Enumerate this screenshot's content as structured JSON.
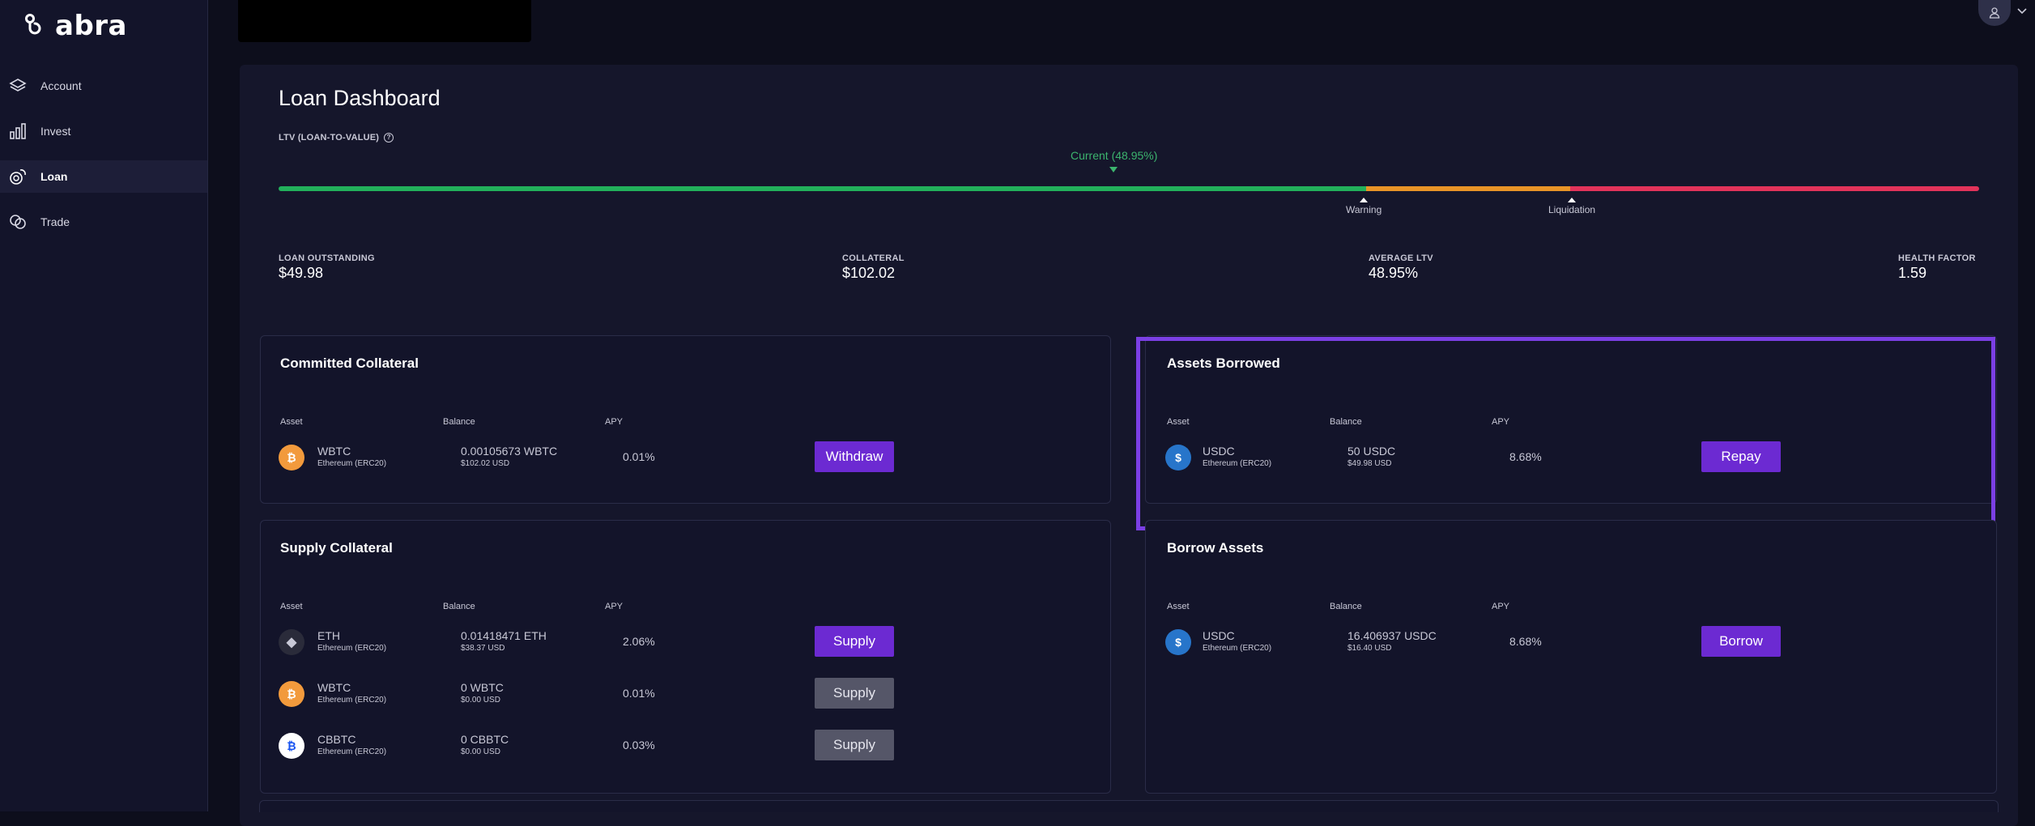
{
  "brand": {
    "name": "abra"
  },
  "sidebar": {
    "items": [
      {
        "label": "Account",
        "icon": "layers-icon"
      },
      {
        "label": "Invest",
        "icon": "bar-chart-icon"
      },
      {
        "label": "Loan",
        "icon": "coins-icon",
        "active": true
      },
      {
        "label": "Trade",
        "icon": "trade-coins-icon"
      }
    ]
  },
  "page": {
    "title": "Loan Dashboard"
  },
  "ltv": {
    "label": "LTV (LOAN-TO-VALUE)",
    "current_label": "Current (48.95%)",
    "warning_label": "Warning",
    "liquidation_label": "Liquidation"
  },
  "stats": {
    "loan_outstanding": {
      "label": "LOAN OUTSTANDING",
      "value": "$49.98"
    },
    "collateral": {
      "label": "COLLATERAL",
      "value": "$102.02"
    },
    "average_ltv": {
      "label": "AVERAGE LTV",
      "value": "48.95%"
    },
    "health_factor": {
      "label": "HEALTH FACTOR",
      "value": "1.59"
    }
  },
  "columns": {
    "asset": "Asset",
    "balance": "Balance",
    "apy": "APY"
  },
  "committed": {
    "title": "Committed Collateral",
    "rows": [
      {
        "name": "WBTC",
        "network": "Ethereum (ERC20)",
        "balance": "0.00105673 WBTC",
        "usd": "$102.02 USD",
        "apy": "0.01%",
        "button": "Withdraw"
      }
    ]
  },
  "borrowed": {
    "title": "Assets Borrowed",
    "rows": [
      {
        "name": "USDC",
        "network": "Ethereum (ERC20)",
        "balance": "50 USDC",
        "usd": "$49.98 USD",
        "apy": "8.68%",
        "button": "Repay"
      }
    ]
  },
  "supply": {
    "title": "Supply Collateral",
    "rows": [
      {
        "name": "ETH",
        "network": "Ethereum (ERC20)",
        "balance": "0.01418471 ETH",
        "usd": "$38.37 USD",
        "apy": "2.06%",
        "button": "Supply"
      },
      {
        "name": "WBTC",
        "network": "Ethereum (ERC20)",
        "balance": "0 WBTC",
        "usd": "$0.00 USD",
        "apy": "0.01%",
        "button": "Supply"
      },
      {
        "name": "CBBTC",
        "network": "Ethereum (ERC20)",
        "balance": "0 CBBTC",
        "usd": "$0.00 USD",
        "apy": "0.03%",
        "button": "Supply"
      }
    ]
  },
  "borrow": {
    "title": "Borrow Assets",
    "rows": [
      {
        "name": "USDC",
        "network": "Ethereum (ERC20)",
        "balance": "16.406937 USDC",
        "usd": "$16.40 USD",
        "apy": "8.68%",
        "button": "Borrow"
      }
    ]
  },
  "colors": {
    "accent": "#6c2ad2",
    "highlight": "#7b3fe4",
    "ltv_green": "#22b05b",
    "ltv_orange": "#e89427",
    "ltv_red": "#e2335a"
  }
}
